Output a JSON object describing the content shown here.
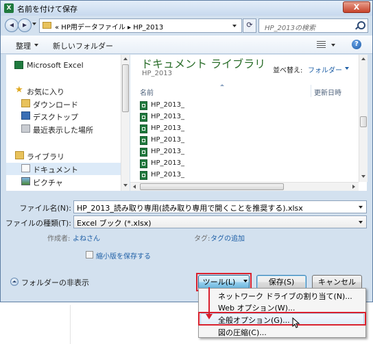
{
  "window": {
    "title": "名前を付けて保存",
    "app_icon": "X≣",
    "close_label": "X"
  },
  "address_bar": {
    "crumbs": "«  HP用データファイル  ▸  HP_2013",
    "search_placeholder": "HP_2013の検索"
  },
  "toolbar": {
    "organize_label": "整理",
    "new_folder_label": "新しいフォルダー"
  },
  "nav_pane": {
    "items": [
      {
        "label": "Microsoft Excel",
        "icon": "excel-icon"
      },
      {
        "label": "お気に入り",
        "icon": "star-icon"
      },
      {
        "label": "ダウンロード",
        "icon": "downloads-folder-icon"
      },
      {
        "label": "デスクトップ",
        "icon": "desktop-icon"
      },
      {
        "label": "最近表示した場所",
        "icon": "recent-places-icon"
      },
      {
        "label": "ライブラリ",
        "icon": "library-icon"
      },
      {
        "label": "ドキュメント",
        "icon": "documents-icon"
      },
      {
        "label": "ピクチャ",
        "icon": "pictures-icon"
      }
    ]
  },
  "content": {
    "library_title": "ドキュメント ライブラリ",
    "library_sub": "HP_2013",
    "arrange_label": "並べ替え:",
    "arrange_value": "フォルダー",
    "columns": [
      "名前",
      "更新日時"
    ],
    "files": [
      "HP_2013_",
      "HP_2013_",
      "HP_2013_",
      "HP_2013_",
      "HP_2013_",
      "HP_2013_",
      "HP_2013_"
    ]
  },
  "form": {
    "filename_label": "ファイル名(N):",
    "filename_value": "HP_2013_読み取り専用(読み取り専用で開くことを推奨する).xlsx",
    "filetype_label": "ファイルの種類(T):",
    "filetype_value": "Excel ブック (*.xlsx)",
    "author_label": "作成者:",
    "author_value": "よねさん",
    "tags_label": "タグ:",
    "tags_value": "タグの追加",
    "thumbnail_label": "縮小版を保存する"
  },
  "footer": {
    "hide_folders_label": "フォルダーの非表示",
    "tools_label": "ツール(L)",
    "save_label": "保存(S)",
    "cancel_label": "キャンセル"
  },
  "tools_menu": {
    "items": [
      "ネットワーク ドライブの割り当て(N)...",
      "Web オプション(W)...",
      "全般オプション(G)...",
      "図の圧縮(C)..."
    ],
    "highlighted_index": 2
  },
  "colors": {
    "accent": "#2b6e2b",
    "link": "#1e5fa6",
    "annotation": "#d9202d"
  }
}
